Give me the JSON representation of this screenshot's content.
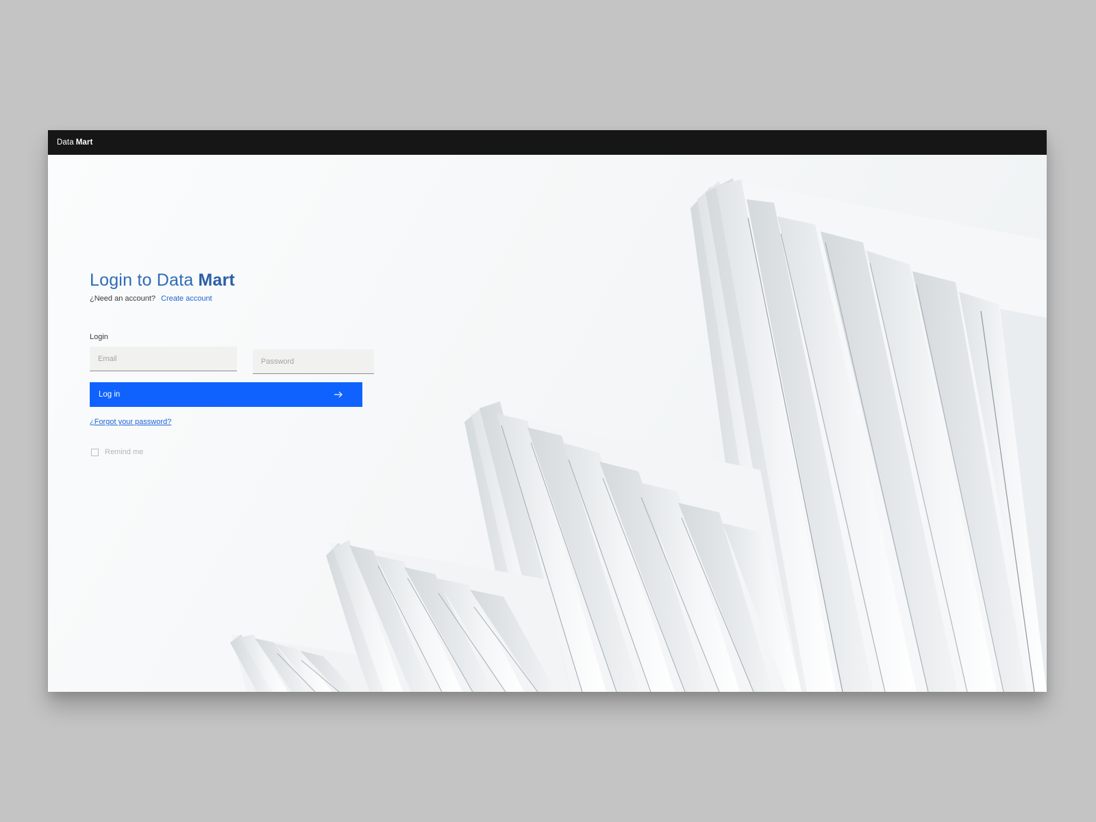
{
  "topbar": {
    "brand_light": "Data",
    "brand_bold": "Mart"
  },
  "login": {
    "title_prefix": "Login to Data",
    "title_bold": "Mart",
    "need_account": "¿Need an account?",
    "create_account": "Create account",
    "section_label": "Login",
    "email_placeholder": "Email",
    "password_placeholder": "Password",
    "login_button": "Log in",
    "forgot_password": "¿Forgot your password?",
    "remember_label": "Remind me",
    "remember_checked": false
  },
  "colors": {
    "accent": "#0f62fe",
    "title": "#2f6bb6",
    "topbar": "#161616",
    "link": "#1f63d8"
  },
  "icons": {
    "login_button_icon": "arrow-right-icon"
  }
}
